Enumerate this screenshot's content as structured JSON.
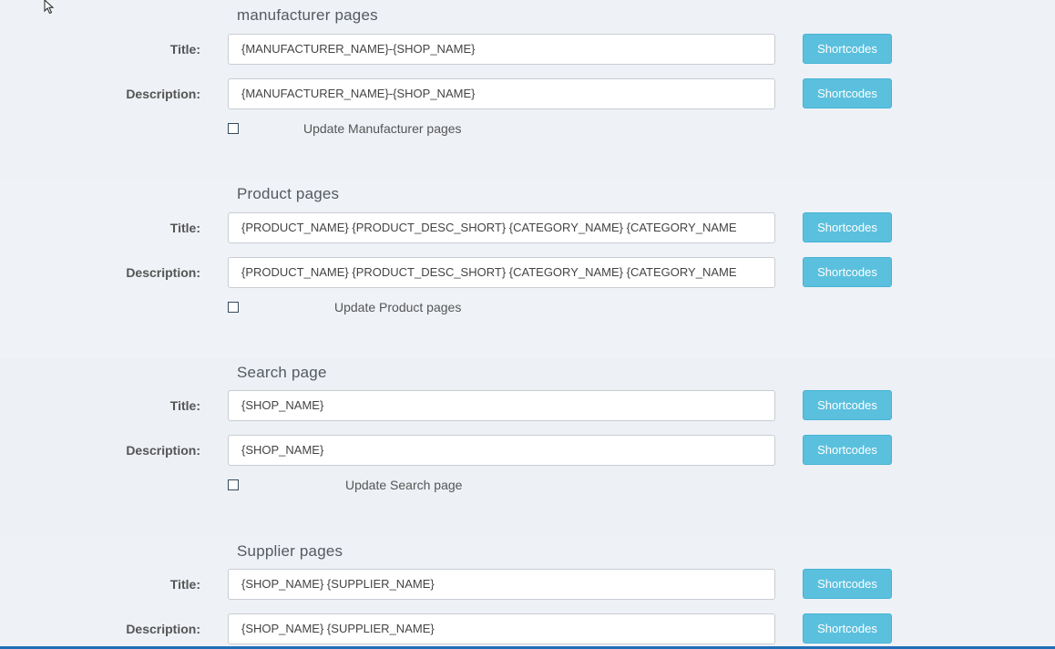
{
  "sections": [
    {
      "title": "manufacturer pages",
      "title_label": "Title:",
      "title_value": "{MANUFACTURER_NAME}-{SHOP_NAME}",
      "description_label": "Description:",
      "description_value": "{MANUFACTURER_NAME}-{SHOP_NAME}",
      "button_label": "Shortcodes",
      "update_label": "Update Manufacturer pages"
    },
    {
      "title": "Product pages",
      "title_label": "Title:",
      "title_value": "{PRODUCT_NAME} {PRODUCT_DESC_SHORT} {CATEGORY_NAME} {CATEGORY_NAME",
      "description_label": "Description:",
      "description_value": "{PRODUCT_NAME} {PRODUCT_DESC_SHORT} {CATEGORY_NAME} {CATEGORY_NAME",
      "button_label": "Shortcodes",
      "update_label": "Update Product pages"
    },
    {
      "title": "Search page",
      "title_label": "Title:",
      "title_value": "{SHOP_NAME}",
      "description_label": "Description:",
      "description_value": "{SHOP_NAME}",
      "button_label": "Shortcodes",
      "update_label": "Update Search page"
    },
    {
      "title": "Supplier pages",
      "title_label": "Title:",
      "title_value": "{SHOP_NAME} {SUPPLIER_NAME}",
      "description_label": "Description:",
      "description_value": "{SHOP_NAME} {SUPPLIER_NAME}",
      "button_label": "Shortcodes"
    }
  ],
  "colors": {
    "button": "#5bc0de",
    "background": "#eef1f6",
    "accent_line": "#1f6fb8"
  }
}
